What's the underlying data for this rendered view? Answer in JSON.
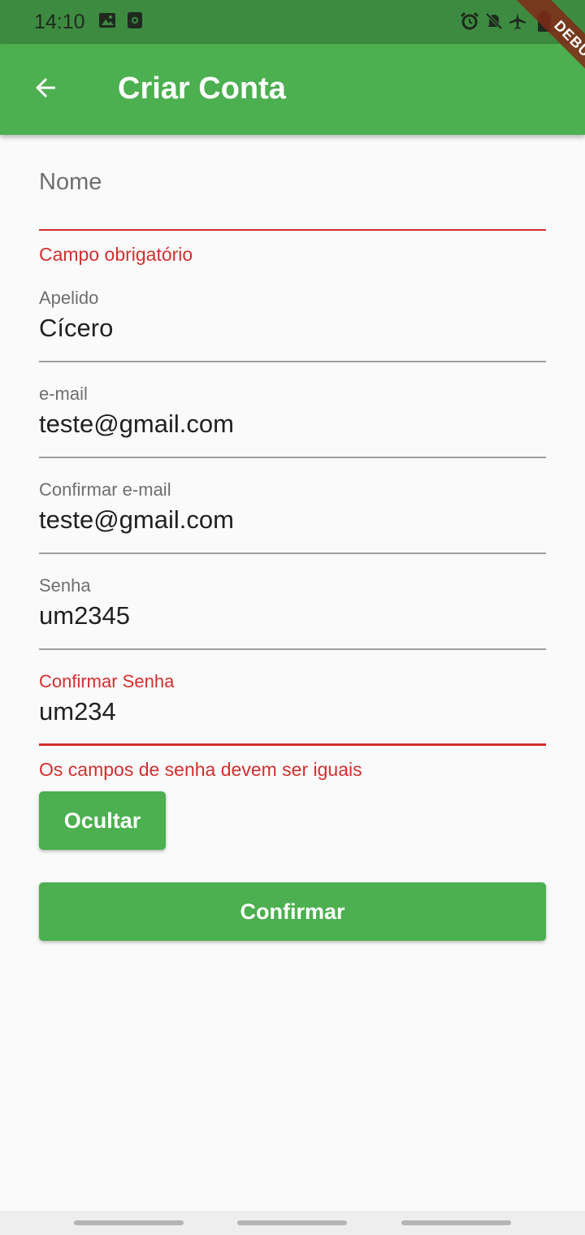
{
  "status_bar": {
    "time": "14:10",
    "left_icons": [
      "image-icon",
      "screen-record-icon"
    ],
    "right_icons": [
      "alarm-icon",
      "mute-icon",
      "airplane-icon",
      "battery-icon"
    ]
  },
  "debug_banner": "DEBUG",
  "app_bar": {
    "back_icon": "arrow-back-icon",
    "title": "Criar Conta"
  },
  "form": {
    "nome": {
      "label": "Nome",
      "value": "",
      "error": "Campo obrigatório"
    },
    "apelido": {
      "label": "Apelido",
      "value": "Cícero"
    },
    "email": {
      "label": "e-mail",
      "value": "teste@gmail.com"
    },
    "confirmar_email": {
      "label": "Confirmar e-mail",
      "value": "teste@gmail.com"
    },
    "senha": {
      "label": "Senha",
      "value": "um2345"
    },
    "confirmar_senha": {
      "label": "Confirmar Senha",
      "value": "um234",
      "error": "Os campos de senha devem ser iguais"
    }
  },
  "buttons": {
    "ocultar": "Ocultar",
    "confirmar": "Confirmar"
  },
  "colors": {
    "primary": "#4caf50",
    "status_bar": "#3d8b40",
    "error": "#d32f2f",
    "background": "#fafafa"
  }
}
